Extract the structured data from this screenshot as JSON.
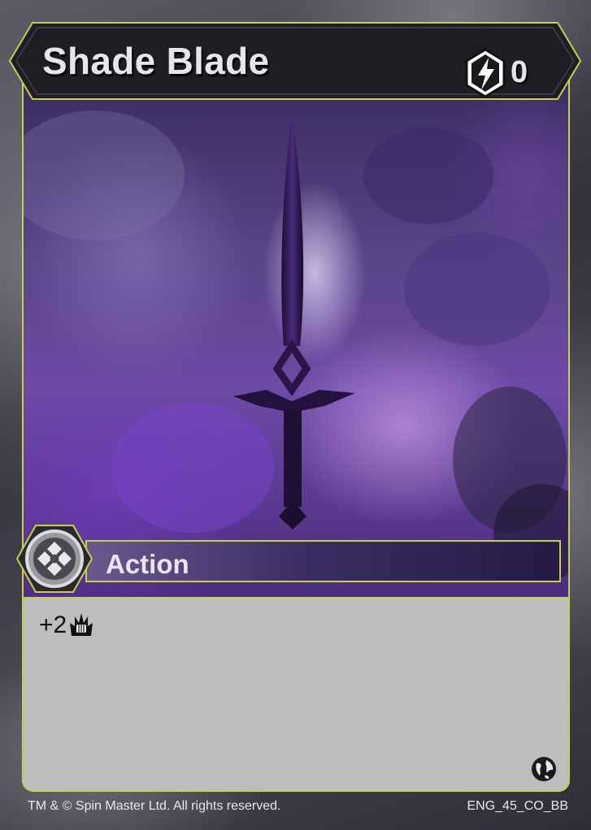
{
  "card": {
    "title": "Shade Blade",
    "energy_cost": "0",
    "energy_icon": "lightning-bolt-icon",
    "type_label": "Action",
    "type_icon": "action-diamond-icon",
    "ability": {
      "text": "+2",
      "icon": "fist-flame-icon"
    },
    "set_icon": "globe-icon",
    "copyright": "TM & © Spin Master Ltd. All rights reserved.",
    "card_code": "ENG_45_CO_BB"
  },
  "colors": {
    "accent_border": "#c5d14a",
    "title_bar": "#1e1d24",
    "art_purple": "#6c4aa6",
    "text_box": "#bdbcbe"
  }
}
